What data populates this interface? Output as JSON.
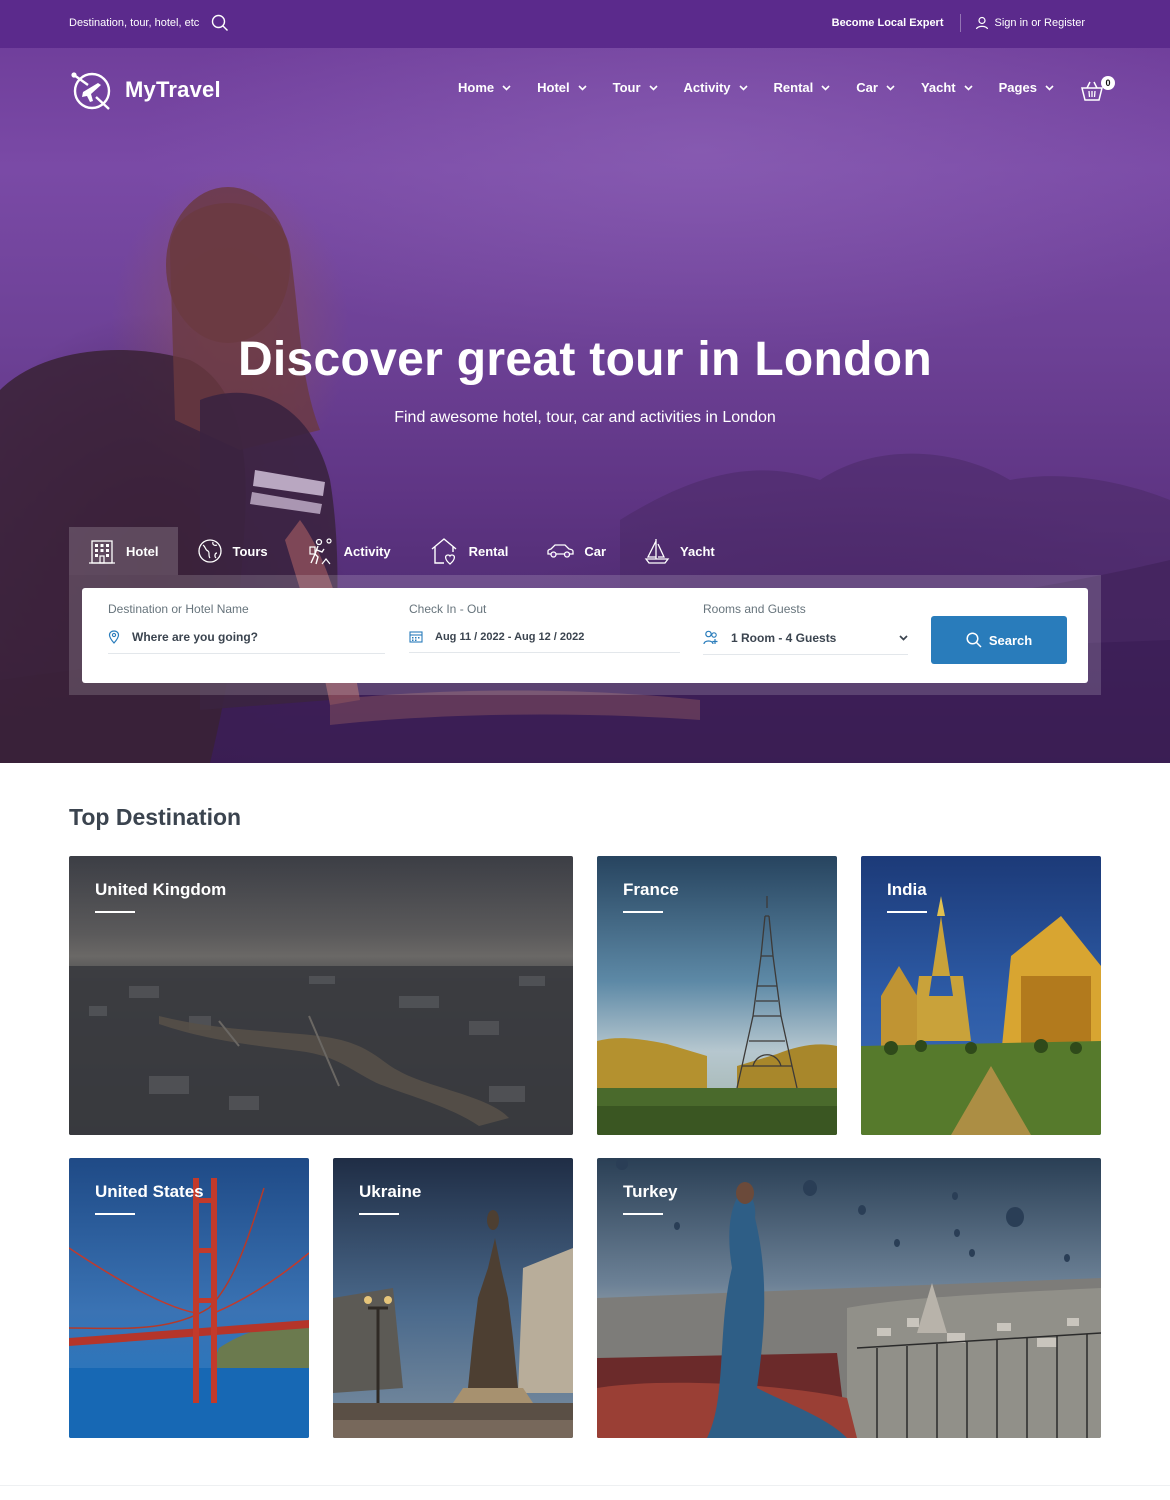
{
  "topbar": {
    "search_placeholder": "Destination, tour, hotel, etc",
    "become_expert": "Become Local Expert",
    "signin": "Sign in or Register"
  },
  "brand": {
    "name": "MyTravel"
  },
  "nav": {
    "items": [
      {
        "label": "Home"
      },
      {
        "label": "Hotel"
      },
      {
        "label": "Tour"
      },
      {
        "label": "Activity"
      },
      {
        "label": "Rental"
      },
      {
        "label": "Car"
      },
      {
        "label": "Yacht"
      },
      {
        "label": "Pages"
      }
    ],
    "cart_count": "0"
  },
  "hero": {
    "title": "Discover great tour in London",
    "subtitle": "Find awesome hotel, tour, car and activities in London"
  },
  "search": {
    "tabs": [
      {
        "label": "Hotel",
        "icon": "building-icon",
        "active": true
      },
      {
        "label": "Tours",
        "icon": "globe-icon"
      },
      {
        "label": "Activity",
        "icon": "hiking-icon"
      },
      {
        "label": "Rental",
        "icon": "house-heart-icon"
      },
      {
        "label": "Car",
        "icon": "car-icon"
      },
      {
        "label": "Yacht",
        "icon": "sailboat-icon"
      }
    ],
    "destination_label": "Destination or Hotel Name",
    "destination_placeholder": "Where are you going?",
    "checkin_label": "Check In - Out",
    "checkin_value": "Aug 11 / 2022 - Aug 12 / 2022",
    "guests_label": "Rooms and Guests",
    "guests_value": "1 Room - 4 Guests",
    "button_label": "Search"
  },
  "destinations": {
    "title": "Top Destination",
    "items": [
      {
        "name": "United Kingdom"
      },
      {
        "name": "France"
      },
      {
        "name": "India"
      },
      {
        "name": "United States"
      },
      {
        "name": "Ukraine"
      },
      {
        "name": "Turkey"
      }
    ]
  },
  "colors": {
    "topbar": "#5b2a8c",
    "primary_button": "#297cbb",
    "heading_text": "#3b444f"
  }
}
